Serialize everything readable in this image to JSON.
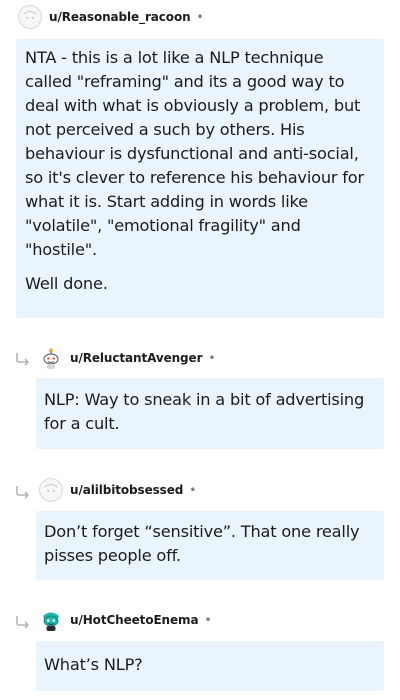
{
  "comments": [
    {
      "username": "u/Reasonable_racoon",
      "separator": "•",
      "avatar_icon": "default-avatar-icon",
      "paragraphs": [
        "NTA - this is a lot like a NLP technique called \"reframing\" and its a good way to deal with what is obviously a problem, but not perceived a such by others. His behaviour is dysfunctional and anti-social, so it's clever to reference his behaviour for what it is. Start adding in words like \"volatile\", \"emotional fragility\" and \"hostile\".",
        "Well done."
      ]
    },
    {
      "username": "u/ReluctantAvenger",
      "separator": "•",
      "avatar_icon": "snoo-avatar-icon",
      "paragraphs": [
        "NLP: Way to sneak in a bit of advertising for a cult."
      ]
    },
    {
      "username": "u/alilbitobsessed",
      "separator": "•",
      "avatar_icon": "default-avatar-icon",
      "paragraphs": [
        "Don’t forget “sensitive”. That one really pisses people off."
      ]
    },
    {
      "username": "u/HotCheetoEnema",
      "separator": "•",
      "avatar_icon": "snoo-avatar-icon",
      "paragraphs": [
        "What’s NLP?"
      ]
    }
  ],
  "colors": {
    "bubble_background": "#eaf4fc",
    "text": "#1c1c1c",
    "muted": "#7c7c7c",
    "reply_arrow": "#b5b5b5",
    "snoo_teal": "#1fb5a8"
  }
}
